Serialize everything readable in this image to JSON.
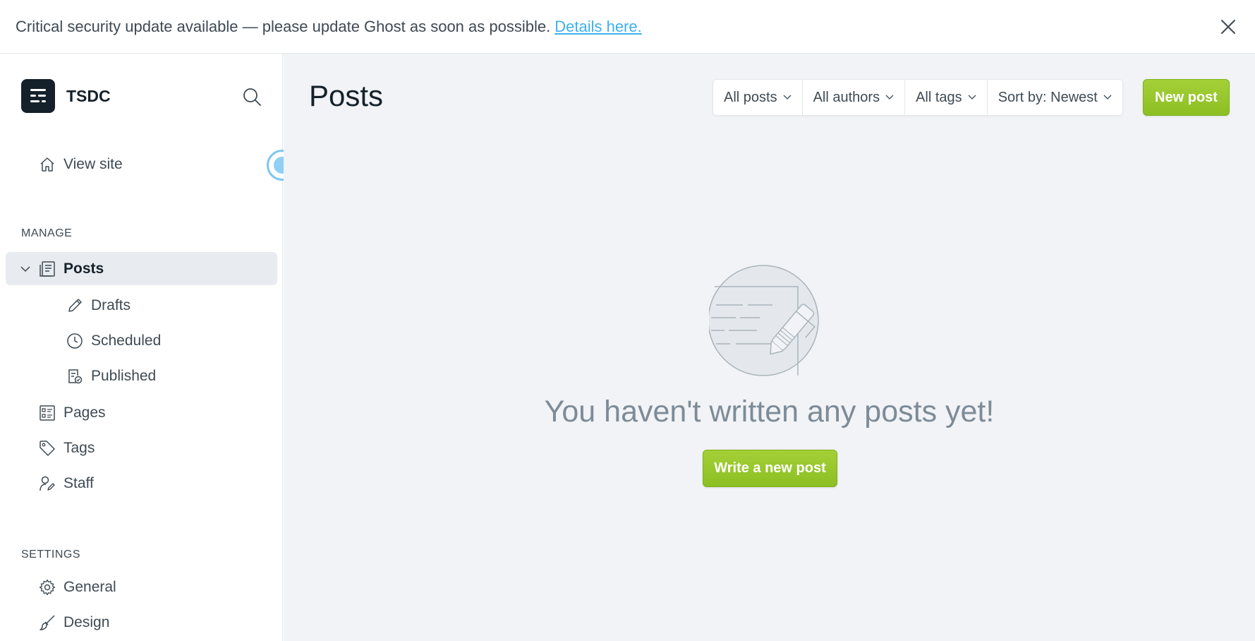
{
  "banner": {
    "message": "Critical security update available — please update Ghost as soon as possible.",
    "link_label": "Details here.",
    "close_icon": "close-icon"
  },
  "sidebar": {
    "brand_name": "TSDC",
    "view_site_label": "View site",
    "manage_label": "MANAGE",
    "posts_label": "Posts",
    "drafts_label": "Drafts",
    "scheduled_label": "Scheduled",
    "published_label": "Published",
    "pages_label": "Pages",
    "tags_label": "Tags",
    "staff_label": "Staff",
    "settings_label": "SETTINGS",
    "general_label": "General",
    "design_label": "Design"
  },
  "main": {
    "title": "Posts",
    "filters": {
      "posts": "All posts",
      "authors": "All authors",
      "tags": "All tags",
      "sort": "Sort by: Newest"
    },
    "new_post_label": "New post",
    "empty_message": "You haven't written any posts yet!",
    "write_button_label": "Write a new post"
  },
  "colors": {
    "accent_green": "#9fcb30",
    "link_blue": "#3eb0ef",
    "sidebar_active": "#e8ebf0",
    "main_bg": "#f1f3f6"
  }
}
